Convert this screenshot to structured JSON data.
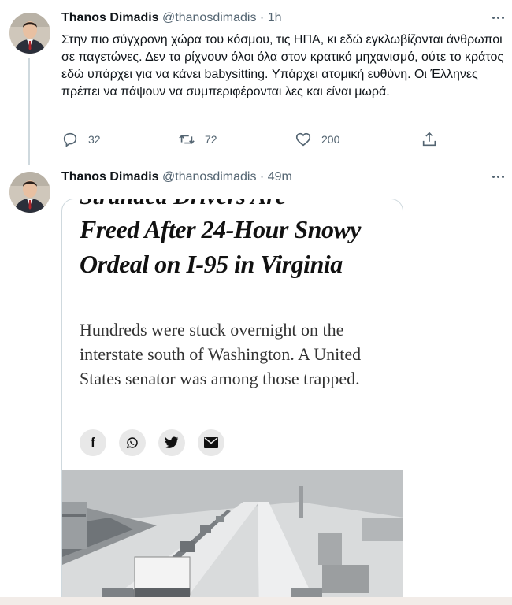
{
  "tweets": [
    {
      "author_name": "Thanos Dimadis",
      "author_handle": "@thanosdimadis",
      "separator": "·",
      "time": "1h",
      "text": "Στην πιο σύγχρονη χώρα του κόσμου, τις ΗΠΑ, κι εδώ εγκλωβίζονται άνθρωποι σε παγετώνες. Δεν τα ρίχνουν όλοι όλα στον κρατικό μηχανισμό, ούτε το κράτος εδώ υπάρχει για να κάνει babysitting. Υπάρχει ατομική ευθύνη. Οι Έλληνες πρέπει να πάψουν να συμπεριφέρονται λες και είναι μωρά.",
      "reply_count": "32",
      "retweet_count": "72",
      "like_count": "200"
    },
    {
      "author_name": "Thanos Dimadis",
      "author_handle": "@thanosdimadis",
      "separator": "·",
      "time": "49m",
      "card": {
        "clipped_heading": "Stranded Drivers Are",
        "headline": "Freed After 24-Hour Snowy Ordeal on I-95 in Virginia",
        "summary": "Hundreds were stuck overnight on the interstate south of Washington. A United States senator was among those trapped.",
        "share_facebook": "f"
      }
    }
  ],
  "icons": {
    "more": "more-icon",
    "reply": "reply-icon",
    "retweet": "retweet-icon",
    "like": "heart-icon",
    "share": "share-icon",
    "facebook": "facebook-icon",
    "whatsapp": "whatsapp-icon",
    "twitter": "twitter-icon",
    "email": "email-icon"
  },
  "colors": {
    "text": "#0f1419",
    "secondary": "#536471",
    "border": "#cfd9de"
  }
}
